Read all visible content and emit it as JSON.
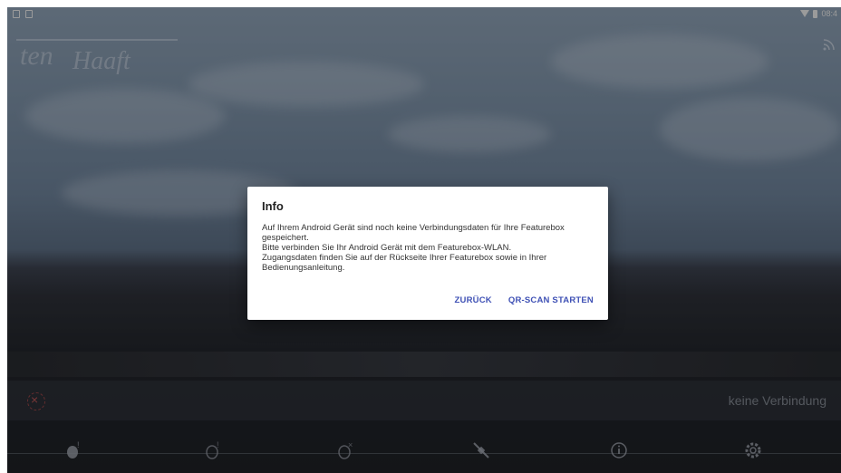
{
  "status_bar": {
    "time": "08:4"
  },
  "logo": {
    "part1": "ten",
    "part2": "Haaft"
  },
  "connection": {
    "status_text": "keine Verbindung"
  },
  "dialog": {
    "title": "Info",
    "message": "Auf Ihrem Android Gerät sind noch keine Verbindungsdaten für Ihre Featurebox gespeichert.\nBitte verbinden Sie Ihr Android Gerät mit dem Featurebox-WLAN.\nZugangsdaten finden Sie auf der Rückseite Ihrer Featurebox sowie in Ihrer Bedienungsanleitung.",
    "back_label": "ZURÜCK",
    "qr_label": "QR-SCAN STARTEN"
  },
  "nav_icons": [
    "satellite-warning-icon",
    "dish-warning-icon",
    "dish-off-icon",
    "satellite-icon",
    "info-icon",
    "settings-icon"
  ],
  "colors": {
    "accent": "#3f51b5",
    "error": "#c85050"
  }
}
